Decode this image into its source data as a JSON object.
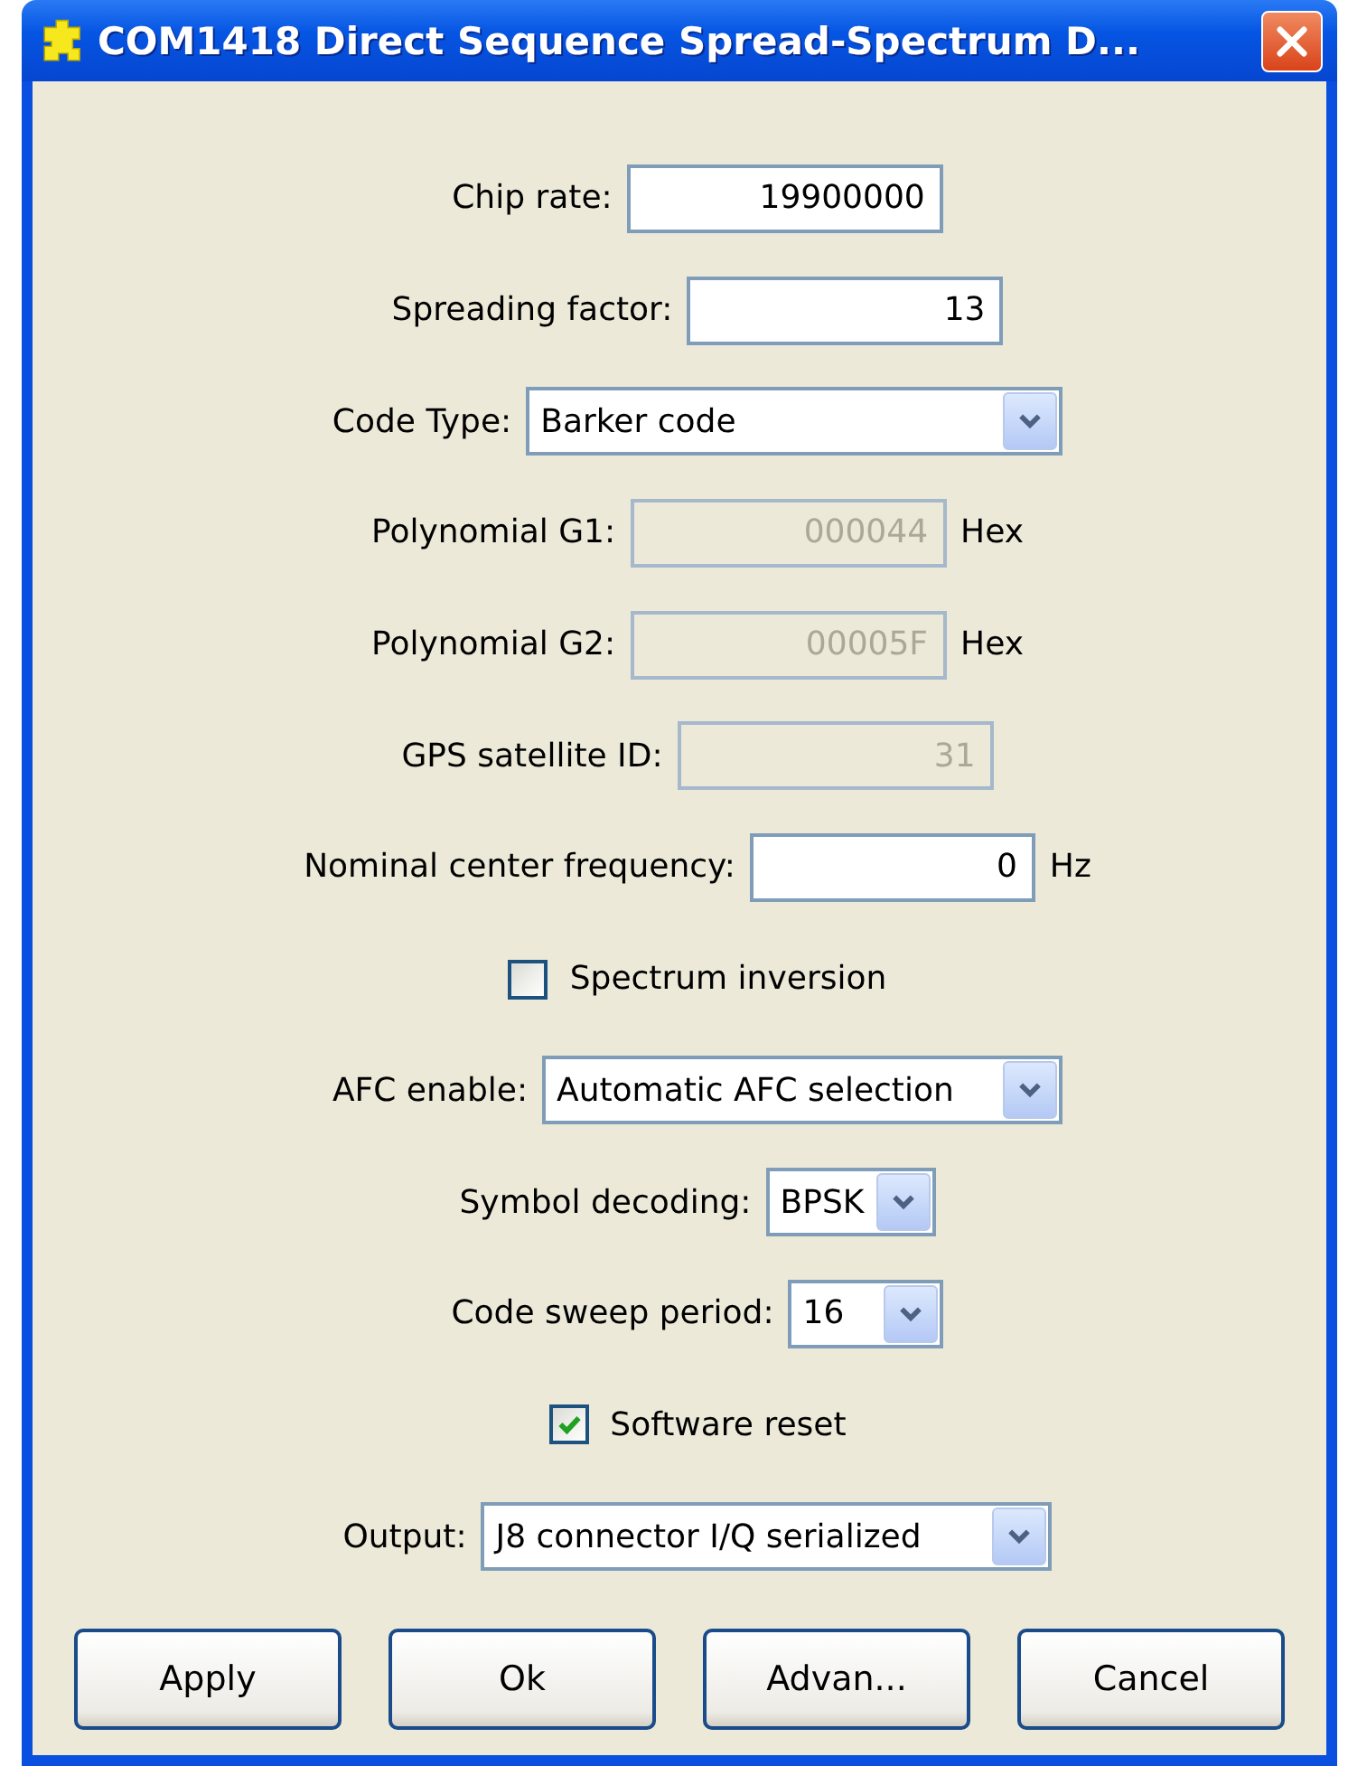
{
  "window": {
    "title": "COM1418 Direct Sequence Spread-Spectrum D..."
  },
  "rows": [
    {
      "kind": "field",
      "label": "Chip rate:",
      "value": "19900000",
      "disabled": false
    },
    {
      "kind": "field",
      "label": "Spreading factor:",
      "value": "13",
      "disabled": false
    },
    {
      "kind": "select",
      "label": "Code Type:",
      "value": "Barker code"
    },
    {
      "kind": "field",
      "label": "Polynomial G1:",
      "value": "000044",
      "disabled": true,
      "unit": "Hex"
    },
    {
      "kind": "field",
      "label": "Polynomial G2:",
      "value": "00005F",
      "disabled": true,
      "unit": "Hex"
    },
    {
      "kind": "field",
      "label": "GPS satellite ID:",
      "value": "31",
      "disabled": true
    },
    {
      "kind": "field",
      "label": "Nominal center frequency:",
      "value": "0",
      "disabled": false,
      "unit": "Hz"
    },
    {
      "kind": "checkbox",
      "label": "Spectrum inversion",
      "checked": false
    },
    {
      "kind": "select",
      "label": "AFC enable:",
      "value": "Automatic AFC selection"
    },
    {
      "kind": "select",
      "label": "Symbol decoding:",
      "value": "BPSK"
    },
    {
      "kind": "select",
      "label": "Code sweep period:",
      "value": "16"
    },
    {
      "kind": "checkbox",
      "label": "Software reset",
      "checked": true
    },
    {
      "kind": "select",
      "label": "Output:",
      "value": "J8 connector I/Q serialized"
    }
  ],
  "buttons": [
    "Apply",
    "Ok",
    "Advan...",
    "Cancel"
  ]
}
